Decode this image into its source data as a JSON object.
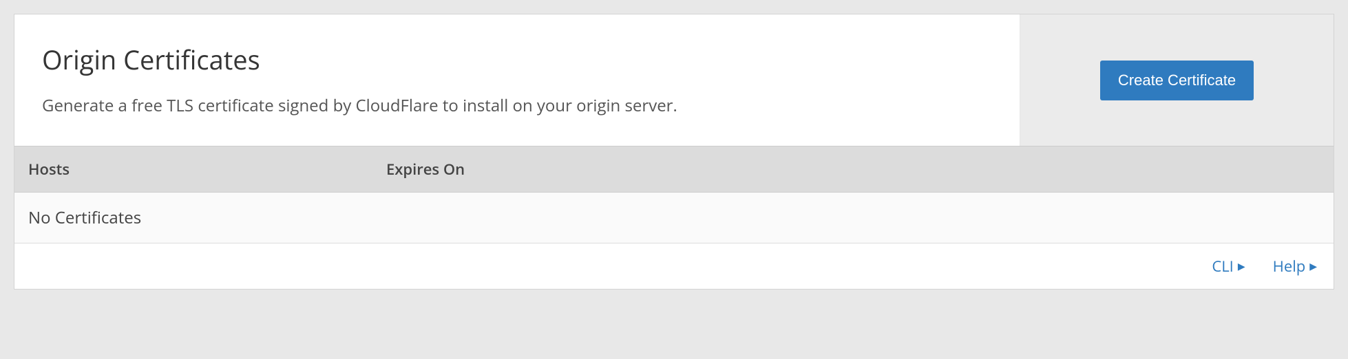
{
  "panel": {
    "title": "Origin Certificates",
    "description": "Generate a free TLS certificate signed by CloudFlare to install on your origin server.",
    "create_button_label": "Create Certificate"
  },
  "table": {
    "columns": {
      "hosts": "Hosts",
      "expires_on": "Expires On"
    },
    "empty_message": "No Certificates"
  },
  "footer": {
    "cli_label": "CLI",
    "help_label": "Help"
  }
}
